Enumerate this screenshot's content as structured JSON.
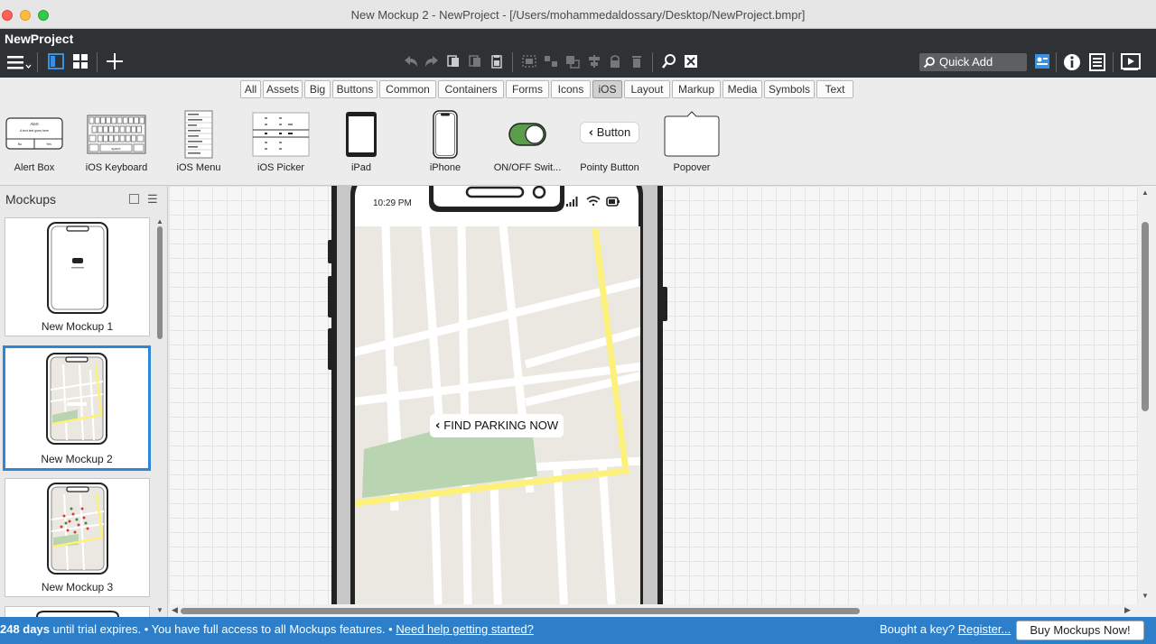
{
  "window": {
    "title": "New Mockup 2 - NewProject - [/Users/mohammedaldossary/Desktop/NewProject.bmpr]"
  },
  "toolbar": {
    "project_name": "NewProject",
    "quick_add_placeholder": "Quick Add"
  },
  "filters": {
    "items": [
      {
        "label": "All"
      },
      {
        "label": "Assets"
      },
      {
        "label": "Big"
      },
      {
        "label": "Buttons"
      },
      {
        "label": "Common"
      },
      {
        "label": "Containers"
      },
      {
        "label": "Forms"
      },
      {
        "label": "Icons"
      },
      {
        "label": "iOS"
      },
      {
        "label": "Layout"
      },
      {
        "label": "Markup"
      },
      {
        "label": "Media"
      },
      {
        "label": "Symbols"
      },
      {
        "label": "Text"
      }
    ],
    "active": "iOS"
  },
  "library": {
    "items": [
      {
        "label": "Alert Box",
        "alert_title": "Alert",
        "alert_text": "A text text goes here",
        "alert_btn1": "No",
        "alert_btn2": "Yes"
      },
      {
        "label": "iOS Keyboard",
        "key_label": "space"
      },
      {
        "label": "iOS Menu"
      },
      {
        "label": "iOS Picker"
      },
      {
        "label": "iPad"
      },
      {
        "label": "iPhone"
      },
      {
        "label": "ON/OFF Swit..."
      },
      {
        "label": "Pointy Button",
        "button_text": "Button"
      },
      {
        "label": "Popover"
      }
    ]
  },
  "sidebar": {
    "title": "Mockups",
    "mockups": [
      {
        "label": "New Mockup 1"
      },
      {
        "label": "New Mockup 2",
        "selected": true
      },
      {
        "label": "New Mockup 3"
      }
    ]
  },
  "canvas": {
    "phone_time": "10:29 PM",
    "map_button_label": "FIND PARKING NOW"
  },
  "status": {
    "days": "248 days",
    "message": " until trial expires. • You have full access to all Mockups features. • ",
    "help_link": "Need help getting started?",
    "bought_text": "Bought a key? ",
    "register_link": "Register...",
    "buy_button": "Buy Mockups Now!"
  },
  "colors": {
    "accent": "#2d7fc9",
    "toolbar_dark": "#2f3234",
    "map_road_highlight": "#fdf17c",
    "map_park": "#b9d4b0",
    "map_base": "#ebe8e2",
    "switch_on": "#5a9e4b"
  },
  "icons": {
    "menu": "hamburger-menu-icon",
    "single_view": "single-view-icon",
    "grid_view": "grid-view-icon",
    "add": "plus-icon",
    "undo": "undo-icon",
    "redo": "redo-icon",
    "search": "search-icon",
    "info": "info-icon",
    "present": "present-icon"
  }
}
